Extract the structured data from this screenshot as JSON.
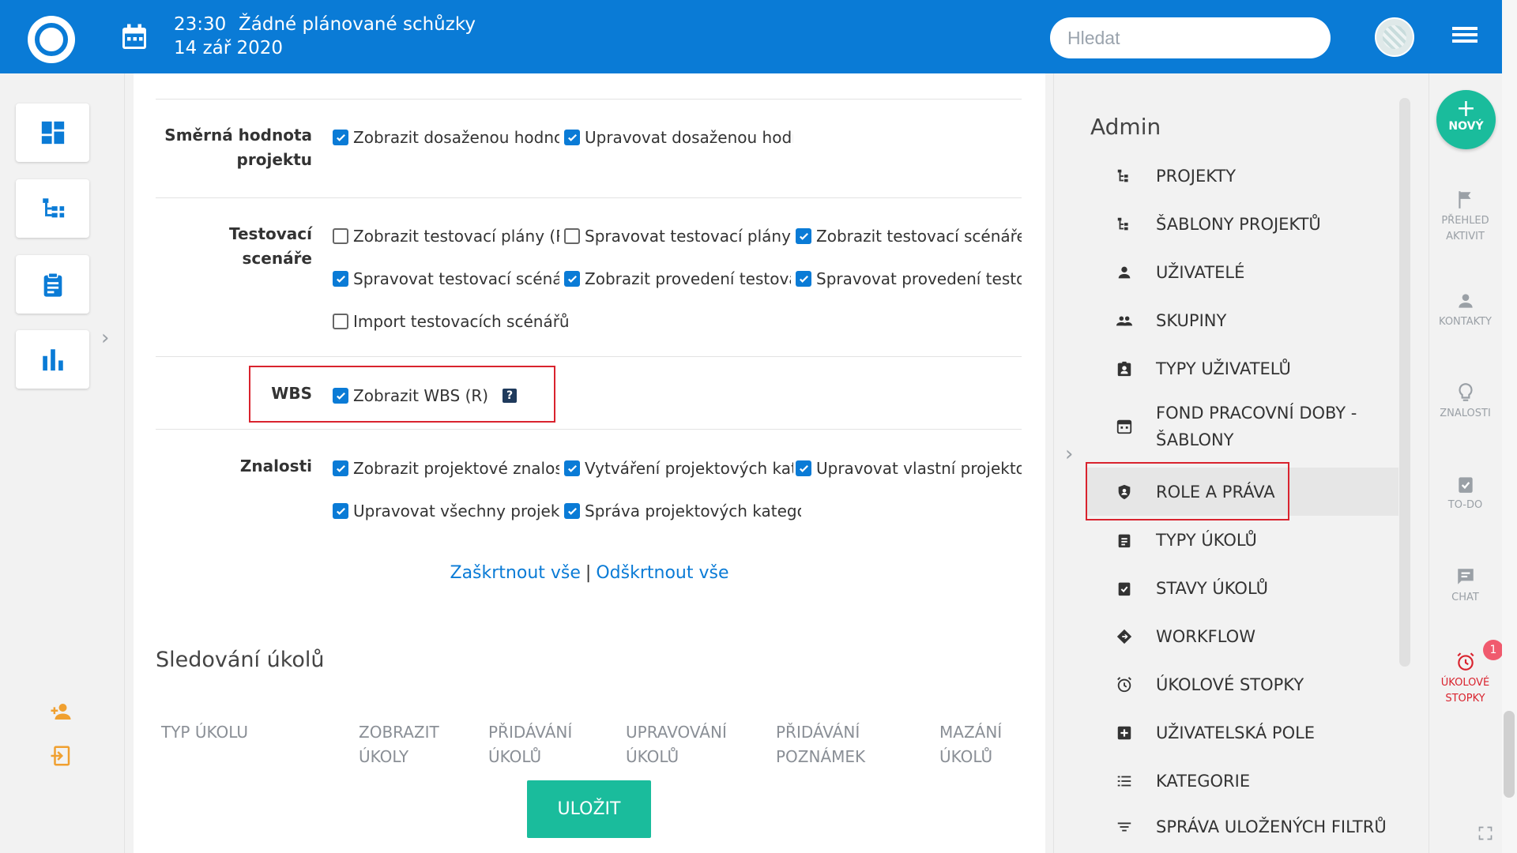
{
  "topbar": {
    "time": "23:30",
    "meeting": "Žádné plánované schůzky",
    "date": "14 zář 2020",
    "search_placeholder": "Hledat",
    "accent": "#0a7bd6"
  },
  "rows": {
    "smerna": {
      "label": "Směrná hodnota projektu",
      "items": [
        "Zobrazit dosaženou hodnot",
        "Upravovat dosaženou hodno"
      ]
    },
    "testovaci": {
      "label": "Testovací scenáře",
      "items": [
        "Zobrazit testovací plány (R)",
        "Spravovat testovací plány",
        "Zobrazit testovací scénáře (I",
        "Spravovat testovací scénáře",
        "Zobrazit provedení testovac",
        "Spravovat provedení testova",
        "Import testovacích scénářů"
      ]
    },
    "wbs": {
      "label": "WBS",
      "items": [
        "Zobrazit WBS (R)"
      ],
      "help": "?"
    },
    "znalosti": {
      "label": "Znalosti",
      "items": [
        "Zobrazit projektové znalost",
        "Vytváření projektových kate",
        "Upravovat vlastní projektov",
        "Upravovat všechny projekto",
        "Správa projektových katego"
      ]
    }
  },
  "links": {
    "check_all": "Zaškrtnout vše",
    "separator": "|",
    "uncheck_all": "Odškrtnout vše"
  },
  "section_title": "Sledování úkolů",
  "table_headers": [
    "Typ úkolu",
    "Zobrazit úkoly",
    "Přidávání úkolů",
    "Upravování úkolů",
    "Přidávání poznámek",
    "Mazání úkolů"
  ],
  "save_label": "ULOŽIT",
  "admin": {
    "title": "Admin",
    "items": [
      "Projekty",
      "Šablony projektů",
      "Uživatelé",
      "Skupiny",
      "Typy uživatelů",
      "Fond pracovní doby - šablony",
      "Role a práva",
      "Typy úkolů",
      "Stavy úkolů",
      "Workflow",
      "Úkolové stopky",
      "Uživatelská pole",
      "Kategorie",
      "Správa uložených filtrů"
    ]
  },
  "rightrail": {
    "new_label": "NOVÝ",
    "items": [
      "Přehled aktivit",
      "Kontakty",
      "Znalosti",
      "To-do",
      "Chat",
      "Úkolové stopky"
    ],
    "badge": "1"
  },
  "colors": {
    "primary": "#0a7bd6",
    "success": "#1abc9c",
    "highlight": "#d9232e"
  }
}
